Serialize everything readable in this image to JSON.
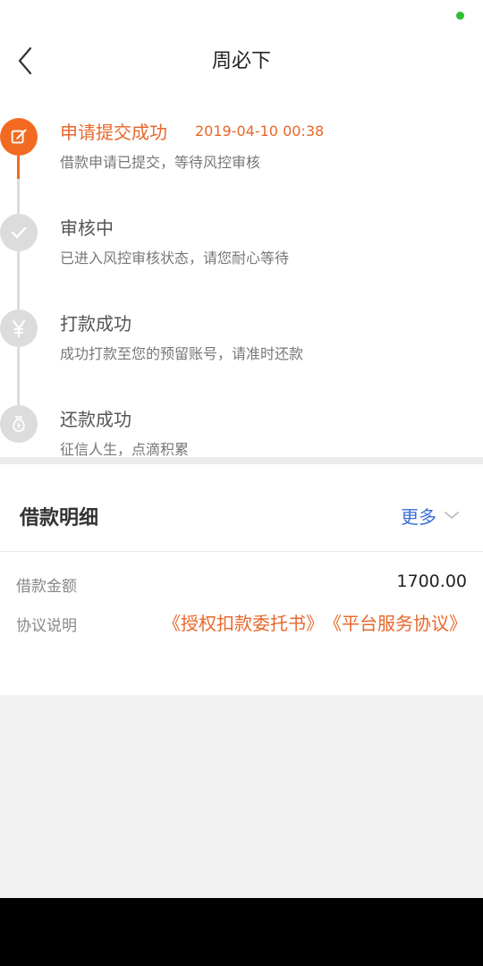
{
  "header": {
    "title": "周必下"
  },
  "timeline": [
    {
      "title": "申请提交成功",
      "time": "2019-04-10 00:38",
      "desc": "借款申请已提交，等待风控审核",
      "icon": "edit-icon",
      "active": true
    },
    {
      "title": "审核中",
      "time": "",
      "desc": "已进入风控审核状态，请您耐心等待",
      "icon": "check-icon",
      "active": false
    },
    {
      "title": "打款成功",
      "time": "",
      "desc": "成功打款至您的预留账号，请准时还款",
      "icon": "yen-icon",
      "active": false
    },
    {
      "title": "还款成功",
      "time": "",
      "desc": "征信人生，点滴积累",
      "icon": "money-bag-icon",
      "active": false
    }
  ],
  "detail": {
    "title": "借款明细",
    "more_label": "更多",
    "rows": [
      {
        "label": "借款金额",
        "value": "1700.00"
      },
      {
        "label": "协议说明",
        "links": [
          "《授权扣款委托书》",
          "《平台服务协议》"
        ]
      }
    ]
  },
  "colors": {
    "accent": "#f26a21",
    "link_blue": "#3a6fd8",
    "inactive": "#dcdcdc"
  }
}
